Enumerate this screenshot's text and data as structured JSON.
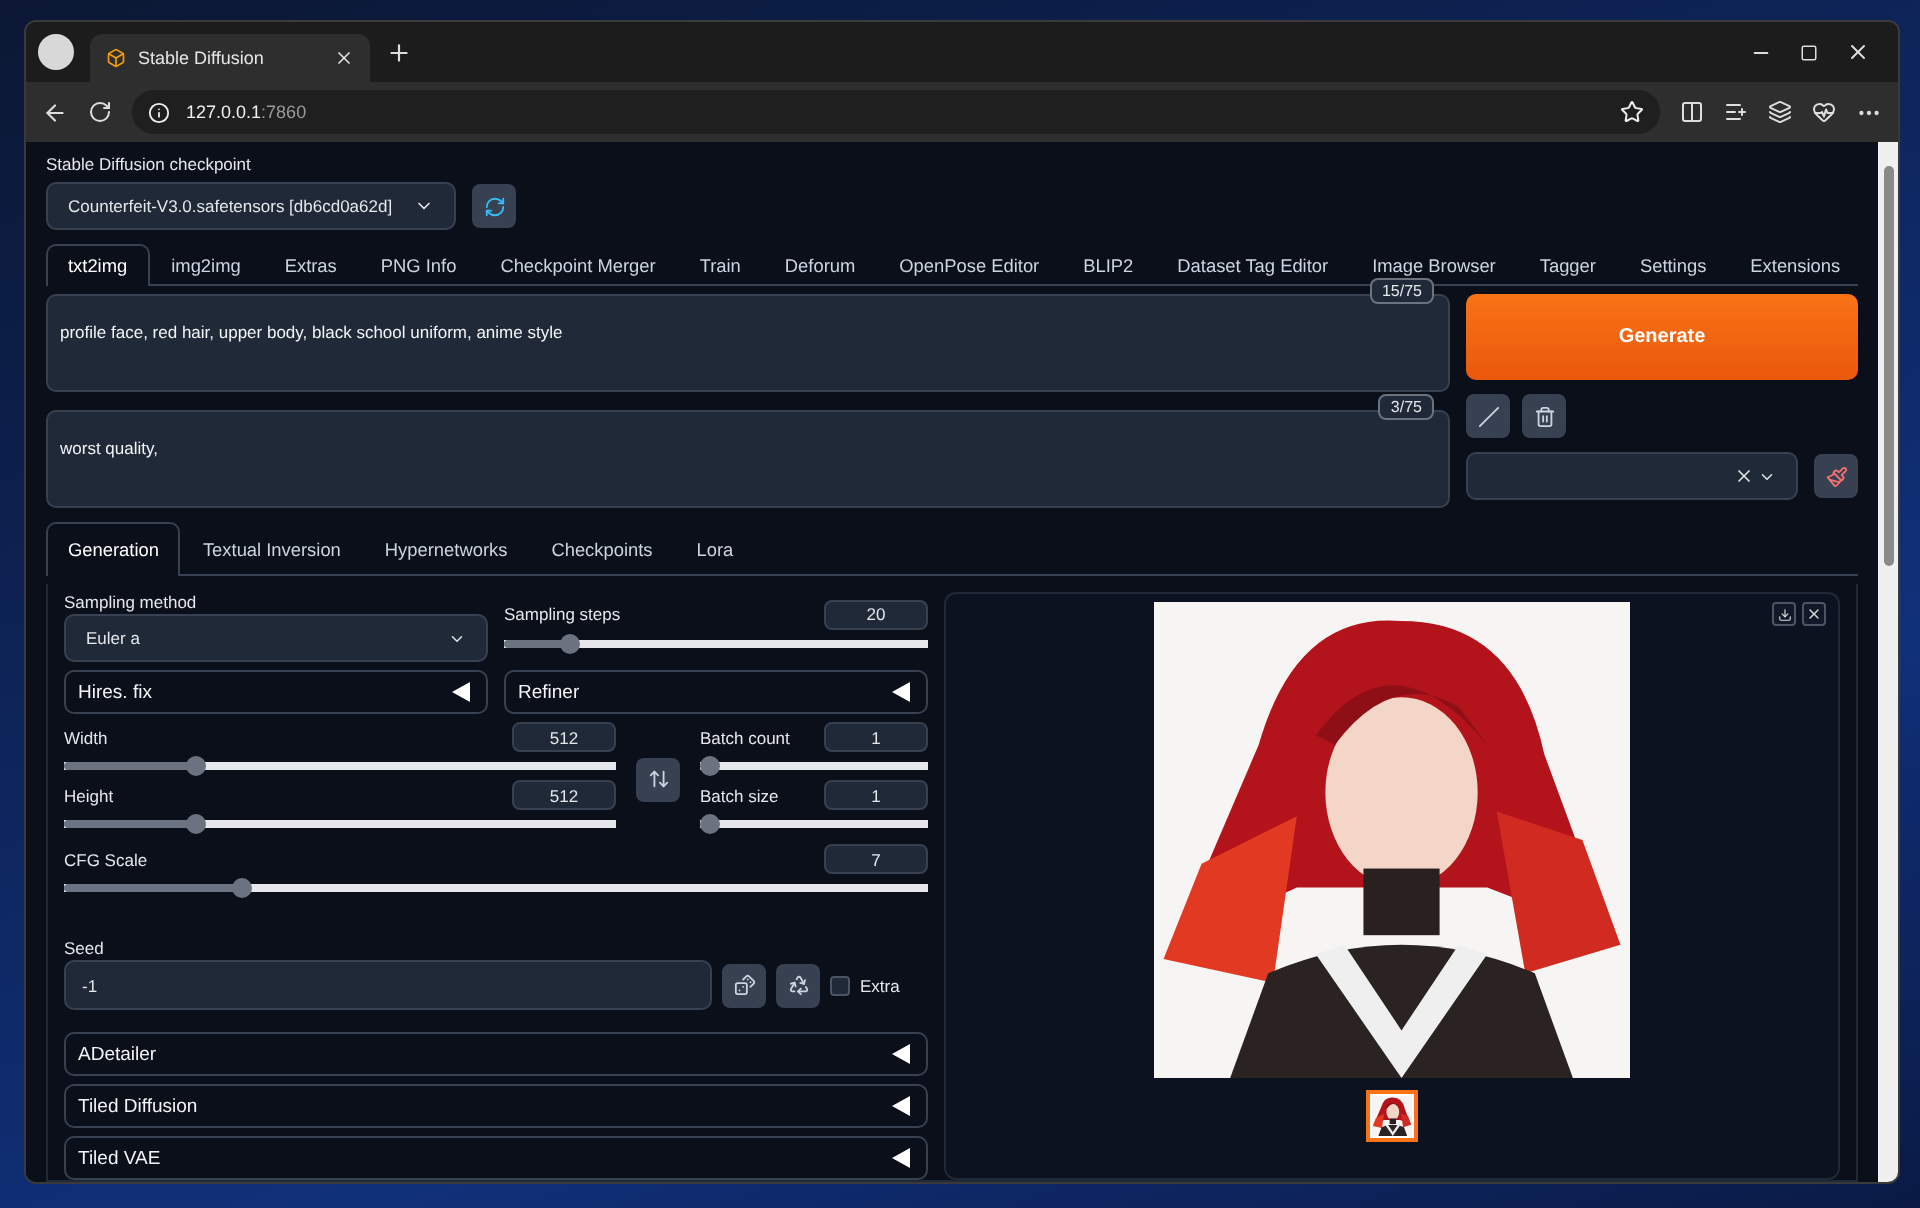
{
  "browser": {
    "tab_title": "Stable Diffusion",
    "url_host": "127.0.0.1",
    "url_port": ":7860"
  },
  "checkpoint": {
    "label": "Stable Diffusion checkpoint",
    "value": "Counterfeit-V3.0.safetensors [db6cd0a62d]"
  },
  "tabs": [
    {
      "label": "txt2img",
      "selected": true
    },
    {
      "label": "img2img",
      "selected": false
    },
    {
      "label": "Extras",
      "selected": false
    },
    {
      "label": "PNG Info",
      "selected": false
    },
    {
      "label": "Checkpoint Merger",
      "selected": false
    },
    {
      "label": "Train",
      "selected": false
    },
    {
      "label": "Deforum",
      "selected": false
    },
    {
      "label": "OpenPose Editor",
      "selected": false
    },
    {
      "label": "BLIP2",
      "selected": false
    },
    {
      "label": "Dataset Tag Editor",
      "selected": false
    },
    {
      "label": "Image Browser",
      "selected": false
    },
    {
      "label": "Tagger",
      "selected": false
    },
    {
      "label": "Settings",
      "selected": false
    },
    {
      "label": "Extensions",
      "selected": false
    }
  ],
  "prompt": {
    "value": "profile face, red hair, upper body, black school uniform, anime style",
    "count": "15/75"
  },
  "negative_prompt": {
    "value": "worst quality,",
    "count": "3/75"
  },
  "generate_label": "Generate",
  "subtabs": [
    {
      "label": "Generation",
      "selected": true
    },
    {
      "label": "Textual Inversion",
      "selected": false
    },
    {
      "label": "Hypernetworks",
      "selected": false
    },
    {
      "label": "Checkpoints",
      "selected": false
    },
    {
      "label": "Lora",
      "selected": false
    }
  ],
  "sampling_method": {
    "label": "Sampling method",
    "value": "Euler a"
  },
  "sampling_steps": {
    "label": "Sampling steps",
    "value": "20",
    "level": 0.14
  },
  "top_accordions": [
    {
      "label": "Hires. fix",
      "expanded": false
    },
    {
      "label": "Refiner",
      "expanded": false
    }
  ],
  "width": {
    "label": "Width",
    "value": "512",
    "level": 0.23
  },
  "height": {
    "label": "Height",
    "value": "512",
    "level": 0.23
  },
  "batch_count": {
    "label": "Batch count",
    "value": "1",
    "level": 0
  },
  "batch_size": {
    "label": "Batch size",
    "value": "1",
    "level": 0
  },
  "cfg_scale": {
    "label": "CFG Scale",
    "value": "7",
    "level": 0.2
  },
  "seed": {
    "label": "Seed",
    "value": "-1"
  },
  "extra": {
    "label": "Extra",
    "checked": false
  },
  "accordions": [
    {
      "label": "ADetailer",
      "expanded": false
    },
    {
      "label": "Tiled Diffusion",
      "expanded": false
    },
    {
      "label": "Tiled VAE",
      "expanded": false
    }
  ],
  "thumbnails": [
    {
      "selected": true
    }
  ]
}
